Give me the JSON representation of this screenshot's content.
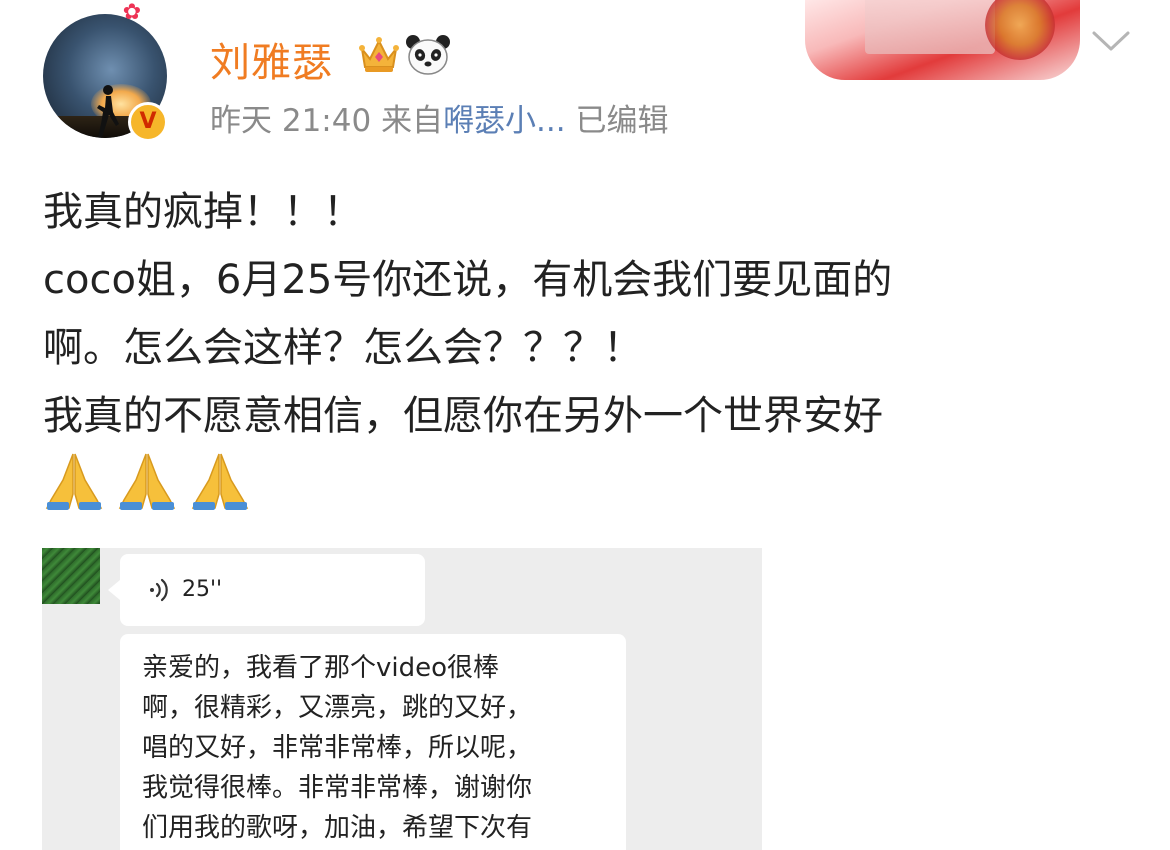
{
  "user": {
    "name": "刘雅瑟",
    "avatar_badge": "V"
  },
  "meta": {
    "time": "昨天 21:40",
    "source_prefix": "来自",
    "source_name": "嘚瑟小...",
    "edited": "已编辑"
  },
  "post": {
    "lines": [
      "我真的疯掉！！！",
      "coco姐，6月25号你还说，有机会我们要见面的",
      "啊。怎么会这样？怎么会？？？！",
      "我真的不愿意相信，但愿你在另外一个世界安好"
    ],
    "emoji": [
      "praying-hands",
      "praying-hands",
      "praying-hands"
    ]
  },
  "screenshot": {
    "voice_duration": "25''",
    "message_lines": [
      "亲爱的，我看了那个video很棒",
      "啊，很精彩，又漂亮，跳的又好，",
      "唱的又好，非常非常棒，所以呢，",
      "我觉得很棒。非常非常棒，谢谢你",
      "们用我的歌呀，加油，希望下次有"
    ]
  },
  "colors": {
    "username": "#f07c22",
    "meta": "#8a8a8a",
    "link": "#5b7fb5",
    "chat_bg": "#ededed"
  },
  "icons": {
    "badges": [
      "crown-icon",
      "panda-icon"
    ],
    "menu": "chevron-down-icon"
  }
}
